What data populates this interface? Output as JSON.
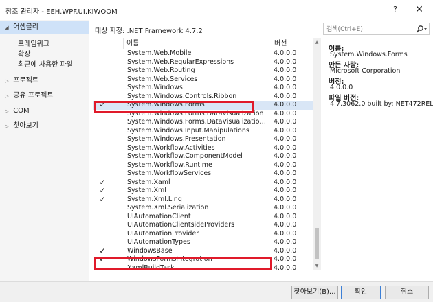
{
  "window": {
    "title": "참조 관리자 - EEH.WPF.UI.KIWOOM",
    "help_label": "?",
    "close_label": "✕"
  },
  "sidebar": {
    "items": [
      {
        "label": "어셈블리",
        "arrow": "◢",
        "selected": true
      },
      {
        "label": "프로젝트",
        "arrow": "▷"
      },
      {
        "label": "공유 프로젝트",
        "arrow": "▷"
      },
      {
        "label": "COM",
        "arrow": "▷"
      },
      {
        "label": "찾아보기",
        "arrow": "▷"
      }
    ],
    "sub_items": [
      "프레임워크",
      "확장",
      "최근에 사용한 파일"
    ]
  },
  "target": {
    "label": "대상 지정: .NET Framework 4.7.2"
  },
  "list": {
    "headers": {
      "name": "이름",
      "version": "버전"
    },
    "rows": [
      {
        "name": "System.Web.Mobile",
        "version": "4.0.0.0",
        "checked": false
      },
      {
        "name": "System.Web.RegularExpressions",
        "version": "4.0.0.0",
        "checked": false
      },
      {
        "name": "System.Web.Routing",
        "version": "4.0.0.0",
        "checked": false
      },
      {
        "name": "System.Web.Services",
        "version": "4.0.0.0",
        "checked": false
      },
      {
        "name": "System.Windows",
        "version": "4.0.0.0",
        "checked": false
      },
      {
        "name": "System.Windows.Controls.Ribbon",
        "version": "4.0.0.0",
        "checked": false
      },
      {
        "name": "System.Windows.Forms",
        "version": "4.0.0.0",
        "checked": true,
        "selected": true
      },
      {
        "name": "System.Windows.Forms.DataVisualization",
        "version": "4.0.0.0",
        "checked": false
      },
      {
        "name": "System.Windows.Forms.DataVisualization.Des...",
        "version": "4.0.0.0",
        "checked": false
      },
      {
        "name": "System.Windows.Input.Manipulations",
        "version": "4.0.0.0",
        "checked": false
      },
      {
        "name": "System.Windows.Presentation",
        "version": "4.0.0.0",
        "checked": false
      },
      {
        "name": "System.Workflow.Activities",
        "version": "4.0.0.0",
        "checked": false
      },
      {
        "name": "System.Workflow.ComponentModel",
        "version": "4.0.0.0",
        "checked": false
      },
      {
        "name": "System.Workflow.Runtime",
        "version": "4.0.0.0",
        "checked": false
      },
      {
        "name": "System.WorkflowServices",
        "version": "4.0.0.0",
        "checked": false
      },
      {
        "name": "System.Xaml",
        "version": "4.0.0.0",
        "checked": true
      },
      {
        "name": "System.Xml",
        "version": "4.0.0.0",
        "checked": true
      },
      {
        "name": "System.Xml.Linq",
        "version": "4.0.0.0",
        "checked": true
      },
      {
        "name": "System.Xml.Serialization",
        "version": "4.0.0.0",
        "checked": false
      },
      {
        "name": "UIAutomationClient",
        "version": "4.0.0.0",
        "checked": false
      },
      {
        "name": "UIAutomationClientsideProviders",
        "version": "4.0.0.0",
        "checked": false
      },
      {
        "name": "UIAutomationProvider",
        "version": "4.0.0.0",
        "checked": false
      },
      {
        "name": "UIAutomationTypes",
        "version": "4.0.0.0",
        "checked": false
      },
      {
        "name": "WindowsBase",
        "version": "4.0.0.0",
        "checked": true
      },
      {
        "name": "WindowsFormsIntegration",
        "version": "4.0.0.0",
        "checked": true
      },
      {
        "name": "XamlBuildTask",
        "version": "4.0.0.0",
        "checked": false
      }
    ],
    "check_mark": "✓"
  },
  "search": {
    "placeholder": "검색(Ctrl+E)",
    "icon": "search-icon"
  },
  "details": {
    "name_label": "이름:",
    "name_value": "System.Windows.Forms",
    "author_label": "만든 사람:",
    "author_value": "Microsoft Corporation",
    "version_label": "버전:",
    "version_value": "4.0.0.0",
    "file_version_label": "파일 버전:",
    "file_version_value": "4.7.3062.0 built by: NET472REL1"
  },
  "footer": {
    "browse_label": "찾아보기(B)...",
    "ok_label": "확인",
    "cancel_label": "취소"
  },
  "colors": {
    "highlight": "#e01a2a",
    "selected_row": "#d9e6f6",
    "selected_sidebar": "#cfe2f8"
  }
}
